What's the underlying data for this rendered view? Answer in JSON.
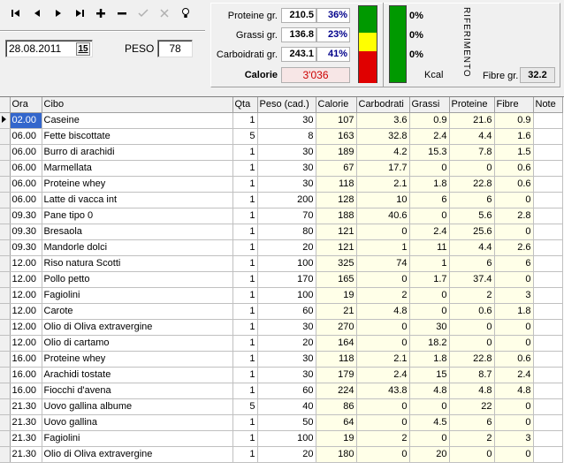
{
  "toolbar": {
    "first_icon": "first-record-icon",
    "prev_icon": "prev-record-icon",
    "next_icon": "next-record-icon",
    "last_icon": "last-record-icon",
    "add_icon": "plus-icon",
    "delete_icon": "minus-icon",
    "post_icon": "check-icon",
    "cancel_icon": "x-icon",
    "bulb_icon": "lightbulb-icon"
  },
  "date": {
    "value": "28.08.2011",
    "cal_label": "15"
  },
  "peso": {
    "label": "PESO",
    "value": "78"
  },
  "nutrition": {
    "proteine": {
      "label": "Proteine gr.",
      "value": "210.5",
      "pct": "36%"
    },
    "grassi": {
      "label": "Grassi gr.",
      "value": "136.8",
      "pct": "23%"
    },
    "carboidrati": {
      "label": "Carboidrati gr.",
      "value": "243.1",
      "pct": "41%"
    },
    "calorie": {
      "label": "Calorie",
      "value": "3'036"
    }
  },
  "riferimento": {
    "title": "RIFERIMENTO",
    "pct1": "0%",
    "pct2": "0%",
    "pct3": "0%",
    "kcal_label": "Kcal",
    "fibre_label": "Fibre gr.",
    "fibre_value": "32.2"
  },
  "colors": {
    "bar_green": "#009900",
    "bar_yellow": "#ffff00",
    "bar_red": "#e00000",
    "selection": "#3366cc",
    "tint": "#ffffe8"
  },
  "table": {
    "columns": [
      "Ora",
      "Cibo",
      "Qta",
      "Peso (cad.)",
      "Calorie",
      "Carbodrati",
      "Grassi",
      "Proteine",
      "Fibre",
      "Note"
    ],
    "rows": [
      [
        "02.00",
        "Caseine",
        "1",
        "30",
        "107",
        "3.6",
        "0.9",
        "21.6",
        "0.9",
        ""
      ],
      [
        "06.00",
        "Fette biscottate",
        "5",
        "8",
        "163",
        "32.8",
        "2.4",
        "4.4",
        "1.6",
        ""
      ],
      [
        "06.00",
        "Burro di arachidi",
        "1",
        "30",
        "189",
        "4.2",
        "15.3",
        "7.8",
        "1.5",
        ""
      ],
      [
        "06.00",
        "Marmellata",
        "1",
        "30",
        "67",
        "17.7",
        "0",
        "0",
        "0.6",
        ""
      ],
      [
        "06.00",
        "Proteine whey",
        "1",
        "30",
        "118",
        "2.1",
        "1.8",
        "22.8",
        "0.6",
        ""
      ],
      [
        "06.00",
        "Latte di vacca int",
        "1",
        "200",
        "128",
        "10",
        "6",
        "6",
        "0",
        ""
      ],
      [
        "09.30",
        "Pane tipo 0",
        "1",
        "70",
        "188",
        "40.6",
        "0",
        "5.6",
        "2.8",
        ""
      ],
      [
        "09.30",
        "Bresaola",
        "1",
        "80",
        "121",
        "0",
        "2.4",
        "25.6",
        "0",
        ""
      ],
      [
        "09.30",
        "Mandorle dolci",
        "1",
        "20",
        "121",
        "1",
        "11",
        "4.4",
        "2.6",
        ""
      ],
      [
        "12.00",
        "Riso natura Scotti",
        "1",
        "100",
        "325",
        "74",
        "1",
        "6",
        "6",
        ""
      ],
      [
        "12.00",
        "Pollo petto",
        "1",
        "170",
        "165",
        "0",
        "1.7",
        "37.4",
        "0",
        ""
      ],
      [
        "12.00",
        "Fagiolini",
        "1",
        "100",
        "19",
        "2",
        "0",
        "2",
        "3",
        ""
      ],
      [
        "12.00",
        "Carote",
        "1",
        "60",
        "21",
        "4.8",
        "0",
        "0.6",
        "1.8",
        ""
      ],
      [
        "12.00",
        "Olio di Oliva extravergine",
        "1",
        "30",
        "270",
        "0",
        "30",
        "0",
        "0",
        ""
      ],
      [
        "12.00",
        "Olio di cartamo",
        "1",
        "20",
        "164",
        "0",
        "18.2",
        "0",
        "0",
        ""
      ],
      [
        "16.00",
        "Proteine whey",
        "1",
        "30",
        "118",
        "2.1",
        "1.8",
        "22.8",
        "0.6",
        ""
      ],
      [
        "16.00",
        "Arachidi tostate",
        "1",
        "30",
        "179",
        "2.4",
        "15",
        "8.7",
        "2.4",
        ""
      ],
      [
        "16.00",
        "Fiocchi d'avena",
        "1",
        "60",
        "224",
        "43.8",
        "4.8",
        "4.8",
        "4.8",
        ""
      ],
      [
        "21.30",
        "Uovo gallina albume",
        "5",
        "40",
        "86",
        "0",
        "0",
        "22",
        "0",
        ""
      ],
      [
        "21.30",
        "Uovo gallina",
        "1",
        "50",
        "64",
        "0",
        "4.5",
        "6",
        "0",
        ""
      ],
      [
        "21.30",
        "Fagiolini",
        "1",
        "100",
        "19",
        "2",
        "0",
        "2",
        "3",
        ""
      ],
      [
        "21.30",
        "Olio di Oliva extravergine",
        "1",
        "20",
        "180",
        "0",
        "20",
        "0",
        "0",
        ""
      ]
    ]
  }
}
